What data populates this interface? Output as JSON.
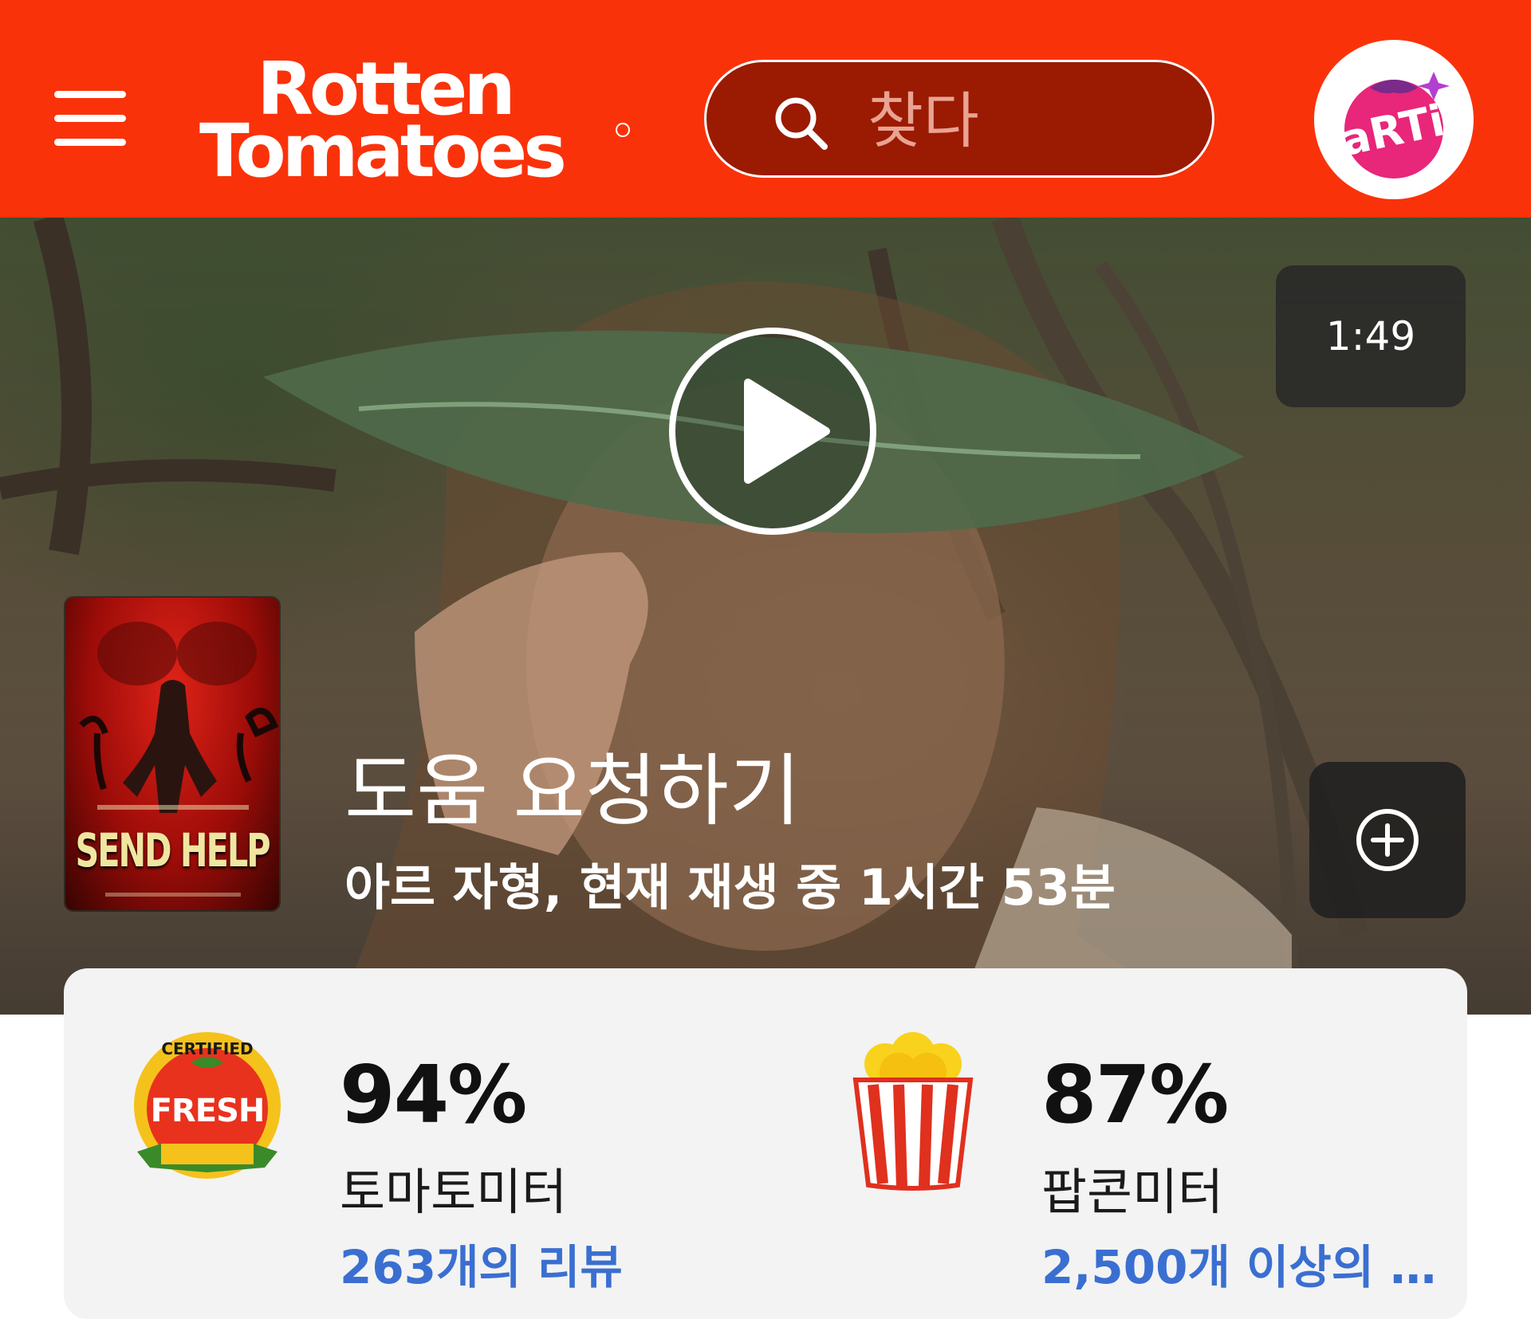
{
  "header": {
    "logo_line1": "Rotten",
    "logo_line2": "Tomatoes",
    "search_placeholder": "찾다",
    "avatar_text": "aRTi"
  },
  "hero": {
    "duration": "1:49",
    "poster_title": "SEND HELP",
    "title": "도움 요청하기",
    "meta": "아르 자형, 현재 재생 중 1시간 53분"
  },
  "scores": {
    "tomatometer": {
      "badge_top": "CERTIFIED",
      "badge_main": "FRESH",
      "value": "94%",
      "label": "토마토미터",
      "reviews": "263개의 리뷰"
    },
    "popcornmeter": {
      "value": "87%",
      "label": "팝콘미터",
      "reviews": "2,500개 이상의 검..."
    }
  },
  "colors": {
    "brand_red": "#fa320a",
    "search_bg": "#9b1a02",
    "link_blue": "#3a6fd1",
    "card_bg": "#f3f3f3"
  }
}
